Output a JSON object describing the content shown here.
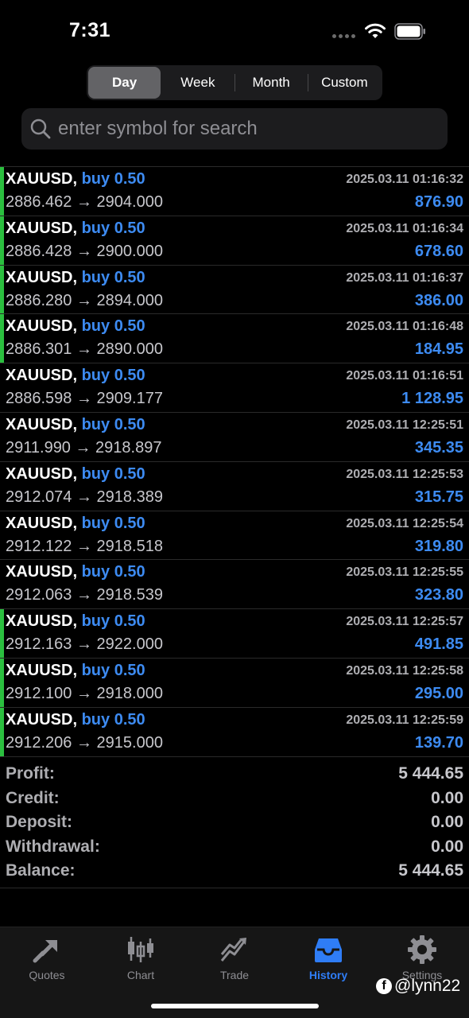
{
  "status_bar": {
    "time": "7:31"
  },
  "periods": [
    {
      "label": "Day",
      "active": true
    },
    {
      "label": "Week",
      "active": false
    },
    {
      "label": "Month",
      "active": false
    },
    {
      "label": "Custom",
      "active": false
    }
  ],
  "search": {
    "placeholder": "enter symbol for search",
    "value": ""
  },
  "trades": [
    {
      "symbol": "XAUUSD,",
      "side": "buy 0.50",
      "prices": "2886.462 → 2904.000",
      "time": "2025.03.11 01:16:32",
      "profit": "876.90",
      "marked": true
    },
    {
      "symbol": "XAUUSD,",
      "side": "buy 0.50",
      "prices": "2886.428 → 2900.000",
      "time": "2025.03.11 01:16:34",
      "profit": "678.60",
      "marked": true
    },
    {
      "symbol": "XAUUSD,",
      "side": "buy 0.50",
      "prices": "2886.280 → 2894.000",
      "time": "2025.03.11 01:16:37",
      "profit": "386.00",
      "marked": true
    },
    {
      "symbol": "XAUUSD,",
      "side": "buy 0.50",
      "prices": "2886.301 → 2890.000",
      "time": "2025.03.11 01:16:48",
      "profit": "184.95",
      "marked": true
    },
    {
      "symbol": "XAUUSD,",
      "side": "buy 0.50",
      "prices": "2886.598 → 2909.177",
      "time": "2025.03.11 01:16:51",
      "profit": "1 128.95",
      "marked": false
    },
    {
      "symbol": "XAUUSD,",
      "side": "buy 0.50",
      "prices": "2911.990 → 2918.897",
      "time": "2025.03.11 12:25:51",
      "profit": "345.35",
      "marked": false
    },
    {
      "symbol": "XAUUSD,",
      "side": "buy 0.50",
      "prices": "2912.074 → 2918.389",
      "time": "2025.03.11 12:25:53",
      "profit": "315.75",
      "marked": false
    },
    {
      "symbol": "XAUUSD,",
      "side": "buy 0.50",
      "prices": "2912.122 → 2918.518",
      "time": "2025.03.11 12:25:54",
      "profit": "319.80",
      "marked": false
    },
    {
      "symbol": "XAUUSD,",
      "side": "buy 0.50",
      "prices": "2912.063 → 2918.539",
      "time": "2025.03.11 12:25:55",
      "profit": "323.80",
      "marked": false
    },
    {
      "symbol": "XAUUSD,",
      "side": "buy 0.50",
      "prices": "2912.163 → 2922.000",
      "time": "2025.03.11 12:25:57",
      "profit": "491.85",
      "marked": true
    },
    {
      "symbol": "XAUUSD,",
      "side": "buy 0.50",
      "prices": "2912.100 → 2918.000",
      "time": "2025.03.11 12:25:58",
      "profit": "295.00",
      "marked": true
    },
    {
      "symbol": "XAUUSD,",
      "side": "buy 0.50",
      "prices": "2912.206 → 2915.000",
      "time": "2025.03.11 12:25:59",
      "profit": "139.70",
      "marked": true
    }
  ],
  "summary": [
    {
      "label": "Profit:",
      "value": "5 444.65"
    },
    {
      "label": "Credit:",
      "value": "0.00"
    },
    {
      "label": "Deposit:",
      "value": "0.00"
    },
    {
      "label": "Withdrawal:",
      "value": "0.00"
    },
    {
      "label": "Balance:",
      "value": "5 444.65"
    }
  ],
  "tabs": [
    {
      "label": "Quotes",
      "icon": "quotes-icon",
      "active": false
    },
    {
      "label": "Chart",
      "icon": "chart-icon",
      "active": false
    },
    {
      "label": "Trade",
      "icon": "trade-icon",
      "active": false
    },
    {
      "label": "History",
      "icon": "history-icon",
      "active": true
    },
    {
      "label": "Settings",
      "icon": "settings-icon",
      "active": false
    }
  ],
  "watermark": {
    "handle": "@lynn22"
  },
  "colors": {
    "accent": "#3d8bf2",
    "active_tab": "#2f7df6",
    "marker": "#2bbf3f",
    "background": "#000000"
  }
}
